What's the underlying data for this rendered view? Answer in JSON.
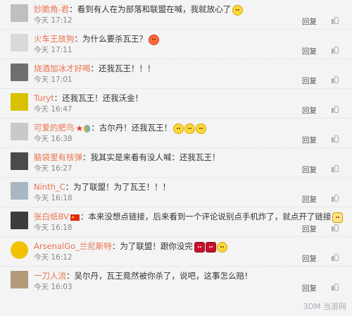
{
  "comments": [
    {
      "user": "妙脆角-君",
      "text": "看到有人在为部落和联盟在喊，我就放心了",
      "time": "今天 17:12",
      "reply": "回复",
      "avatar_color": "#bfbfbf",
      "badges": [],
      "emojis": [
        "smile"
      ]
    },
    {
      "user": "火车王放狗",
      "text": "为什么要杀瓦王？",
      "time": "今天 17:11",
      "reply": "回复",
      "avatar_color": "#d9d9d9",
      "badges": [],
      "emojis": [
        "angry"
      ]
    },
    {
      "user": "烧酒加冰才好喝",
      "text": "还我瓦王！！！",
      "time": "今天 17:01",
      "reply": "回复",
      "avatar_color": "#6e6e6e",
      "badges": [],
      "emojis": []
    },
    {
      "user": "Turyt",
      "text": "还我瓦王！还我沃金！",
      "time": "今天 16:47",
      "reply": "回复",
      "avatar_color": "#d8c200",
      "badges": [],
      "emojis": []
    },
    {
      "user": "可爱的肥鸟",
      "text": "古尔丹！还我瓦王！",
      "time": "今天 16:38",
      "reply": "回复",
      "avatar_color": "#c9c9c9",
      "badges": [
        "star",
        "balloon"
      ],
      "emojis": [
        "sad",
        "sad",
        "sad"
      ]
    },
    {
      "user": "脑袋里有核弹",
      "text": "我其实是来看有没人喊：还我瓦王！",
      "time": "今天 16:27",
      "reply": "回复",
      "avatar_color": "#4a4a4a",
      "badges": [],
      "emojis": []
    },
    {
      "user": "Ninth_C",
      "text": "为了联盟！为了瓦王！！！",
      "time": "今天 16:18",
      "reply": "回复",
      "avatar_color": "#a9b7c4",
      "badges": [],
      "emojis": []
    },
    {
      "user": "张白纸BV",
      "text": "本来没想点链接，后来看到一个评论说别点手机炸了，就点开了链接",
      "time": "今天 16:18",
      "reply": "回复",
      "avatar_color": "#3d3d3d",
      "badges": [
        "flag"
      ],
      "emojis": [
        "cat"
      ]
    },
    {
      "user": "ArsenalGo_兰尼斯特",
      "text": "为了联盟！跟你没完",
      "time": "今天 16:12",
      "reply": "回复",
      "avatar_color": "#f2c200",
      "badges": [],
      "emojis": [
        "x",
        "x",
        "smirk"
      ]
    },
    {
      "user": "一刀人流",
      "text": "吴尔丹，瓦王竟然被你杀了，说吧，这事怎么赔！",
      "time": "今天 16:03",
      "reply": "回复",
      "avatar_color": "#b59a7a",
      "badges": [],
      "emojis": []
    }
  ],
  "watermark": "3DM 当游网"
}
